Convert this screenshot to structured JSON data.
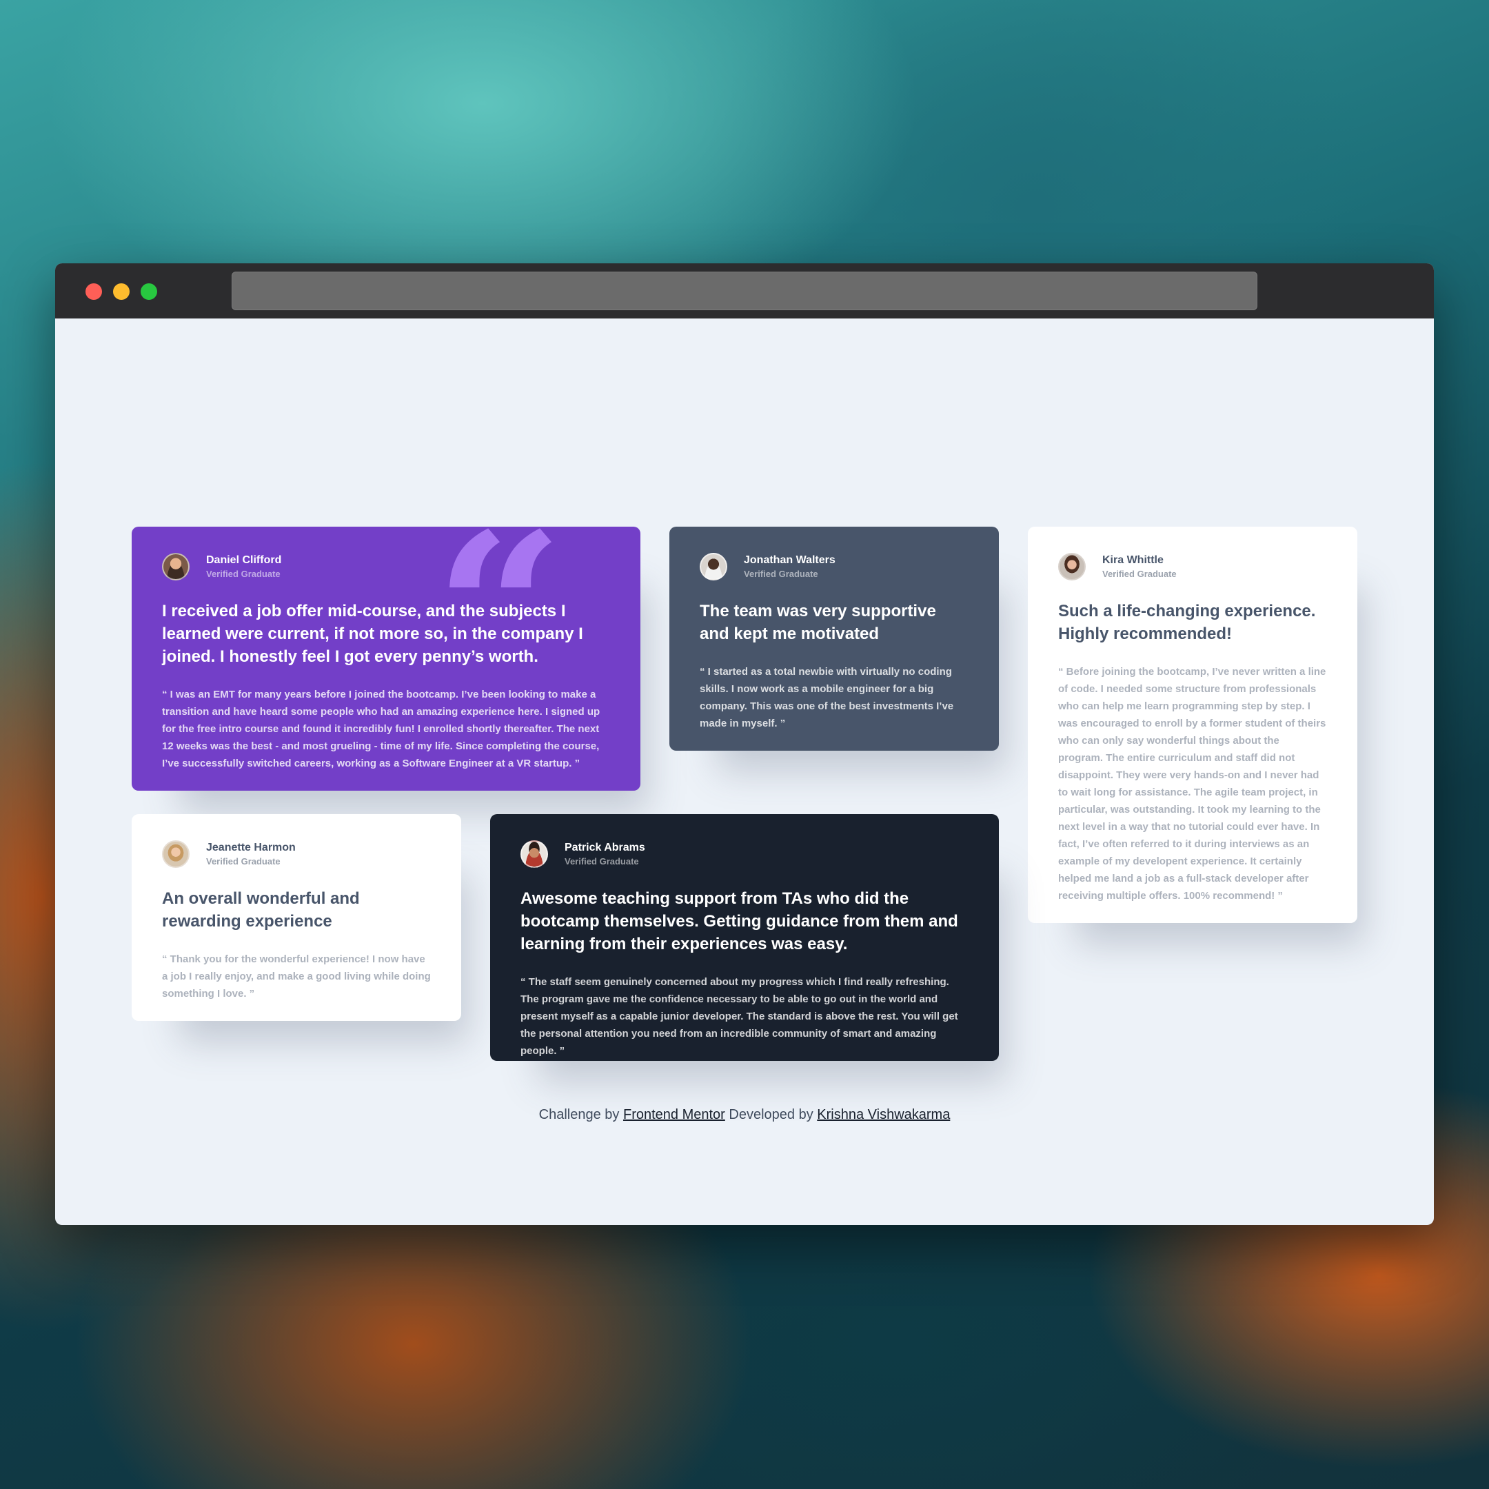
{
  "browser": {
    "controls": [
      "close",
      "minimize",
      "maximize"
    ],
    "address_bar": ""
  },
  "colors": {
    "purple": "#733fc8",
    "slate": "#48556a",
    "white": "#ffffff",
    "dark": "#19212e",
    "page_bg": "#edf2f8",
    "quote_accent": "#a775f1"
  },
  "testimonials": [
    {
      "name": "Daniel Clifford",
      "role": "Verified Graduate",
      "headline": "I received a job offer mid-course, and the subjects I learned were current, if not more so, in the company I joined. I honestly feel I got every penny’s worth.",
      "quote": "“ I was an EMT for many years before I joined the bootcamp. I’ve been looking to make a transition and have heard some people who had an amazing experience here. I signed up for the free intro course and found it incredibly fun! I enrolled shortly thereafter. The next 12 weeks was the best - and most grueling - time of my life. Since completing the course, I’ve successfully switched careers, working as a Software Engineer at a VR startup. ”"
    },
    {
      "name": "Jonathan Walters",
      "role": "Verified Graduate",
      "headline": "The team was very supportive and kept me motivated",
      "quote": "“ I started as a total newbie with virtually no coding skills. I now work as a mobile engineer for a big company. This was one of the best investments I’ve made in myself. ”"
    },
    {
      "name": "Kira Whittle",
      "role": "Verified Graduate",
      "headline": "Such a life-changing experience. Highly recommended!",
      "quote": "“ Before joining the bootcamp, I’ve never written a line of code. I needed some structure from professionals who can help me learn programming step by step. I was encouraged to enroll by a former student of theirs who can only say wonderful things about the program. The entire curriculum and staff did not disappoint. They were very hands-on and I never had to wait long for assistance. The agile team project, in particular, was outstanding. It took my learning to the next level in a way that no tutorial could ever have. In fact, I’ve often referred to it during interviews as an example of my developent experience. It certainly helped me land a job as a full-stack developer after receiving multiple offers. 100% recommend! ”"
    },
    {
      "name": "Jeanette Harmon",
      "role": "Verified Graduate",
      "headline": "An overall wonderful and rewarding experience",
      "quote": "“ Thank you for the wonderful experience! I now have a job I really enjoy, and make a good living while doing something I love. ”"
    },
    {
      "name": "Patrick Abrams",
      "role": "Verified Graduate",
      "headline": "Awesome teaching support from TAs who did the bootcamp themselves. Getting guidance from them and learning from their experiences was easy.",
      "quote": "“ The staff seem genuinely concerned about my progress which I find really refreshing. The program gave me the confidence necessary to be able to go out in the world and present myself as a capable junior developer. The standard is above the rest. You will get the personal attention you need from an incredible community of smart and amazing people. ”"
    }
  ],
  "attribution": {
    "challenge_prefix": "Challenge by",
    "challenge_link": "Frontend Mentor",
    "developer_prefix": "Developed by",
    "developer_link": "Krishna Vishwakarma"
  }
}
